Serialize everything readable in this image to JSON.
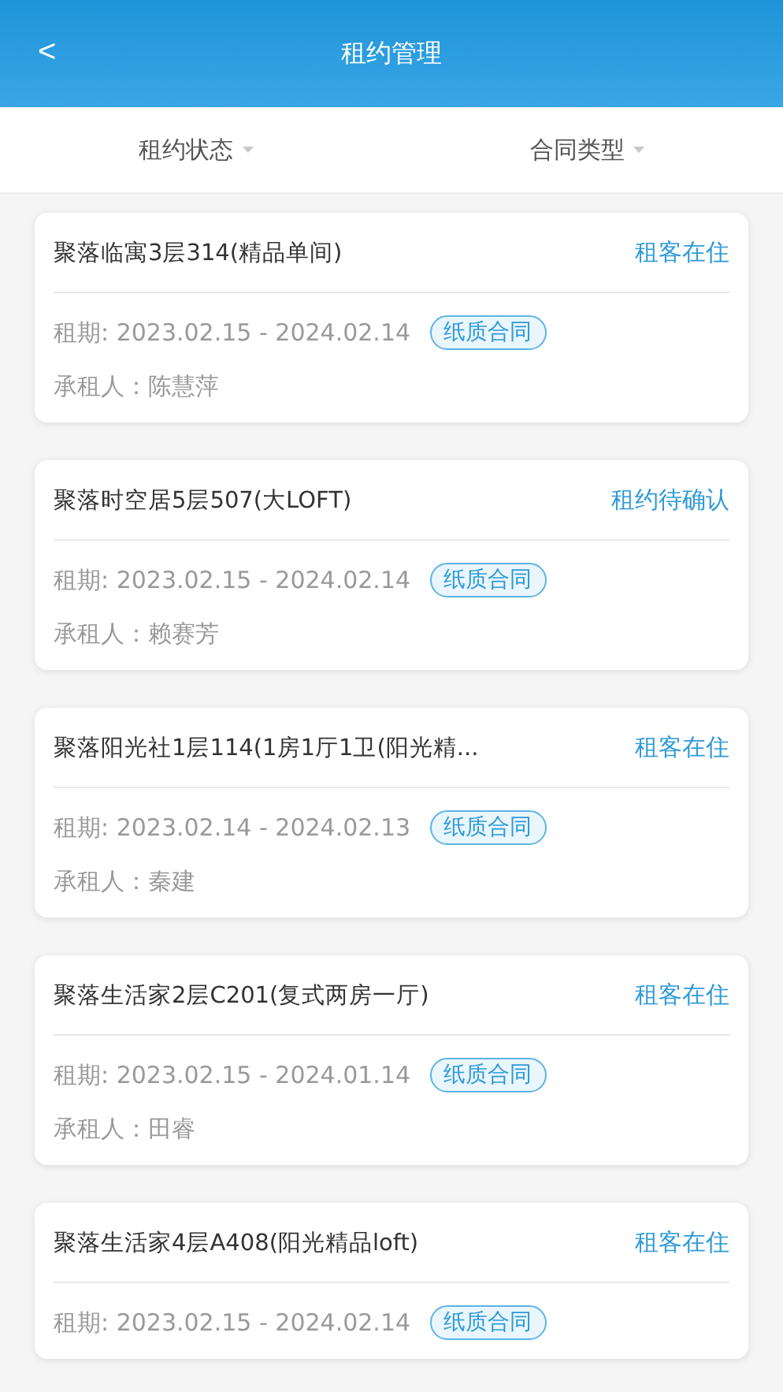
{
  "header": {
    "back": "<",
    "title": "租约管理"
  },
  "filters": [
    {
      "label": "租约状态"
    },
    {
      "label": "合同类型"
    }
  ],
  "leases": [
    {
      "title": "聚落临寓3层314(精品单间)",
      "status": "租客在住",
      "period": "租期: 2023.02.15 - 2024.02.14",
      "tag": "纸质合同",
      "tenant": "承租人：陈慧萍"
    },
    {
      "title": "聚落时空居5层507(大LOFT)",
      "status": "租约待确认",
      "period": "租期: 2023.02.15 - 2024.02.14",
      "tag": "纸质合同",
      "tenant": "承租人：赖赛芳"
    },
    {
      "title": "聚落阳光社1层114(1房1厅1卫(阳光精...",
      "status": "租客在住",
      "period": "租期: 2023.02.14 - 2024.02.13",
      "tag": "纸质合同",
      "tenant": "承租人：秦建"
    },
    {
      "title": "聚落生活家2层C201(复式两房一厅)",
      "status": "租客在住",
      "period": "租期: 2023.02.15 - 2024.01.14",
      "tag": "纸质合同",
      "tenant": "承租人：田睿"
    },
    {
      "title": "聚落生活家4层A408(阳光精品loft)",
      "status": "租客在住",
      "period": "租期: 2023.02.15 - 2024.02.14",
      "tag": "纸质合同"
    }
  ]
}
